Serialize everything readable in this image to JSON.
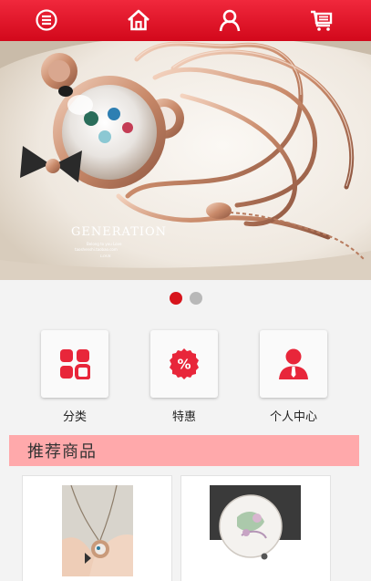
{
  "topbar": {
    "icons": [
      "menu-icon",
      "home-icon",
      "user-icon",
      "cart-icon"
    ]
  },
  "banner": {
    "brand_text": "GENERATION",
    "tagline": "Belong to you Love",
    "url_text": "taoshenshi.taobao.com",
    "small_text": "LOVE"
  },
  "carousel": {
    "total": 2,
    "active": 1
  },
  "quick_menu": [
    {
      "label": "分类",
      "icon": "grid-icon"
    },
    {
      "label": "特惠",
      "icon": "percent-badge-icon"
    },
    {
      "label": "个人中心",
      "icon": "person-icon"
    }
  ],
  "section": {
    "title": "推荐商品"
  },
  "colors": {
    "primary": "#d7141c",
    "section_bg": "#ffa9ab",
    "page_bg": "#f3f3f3"
  }
}
